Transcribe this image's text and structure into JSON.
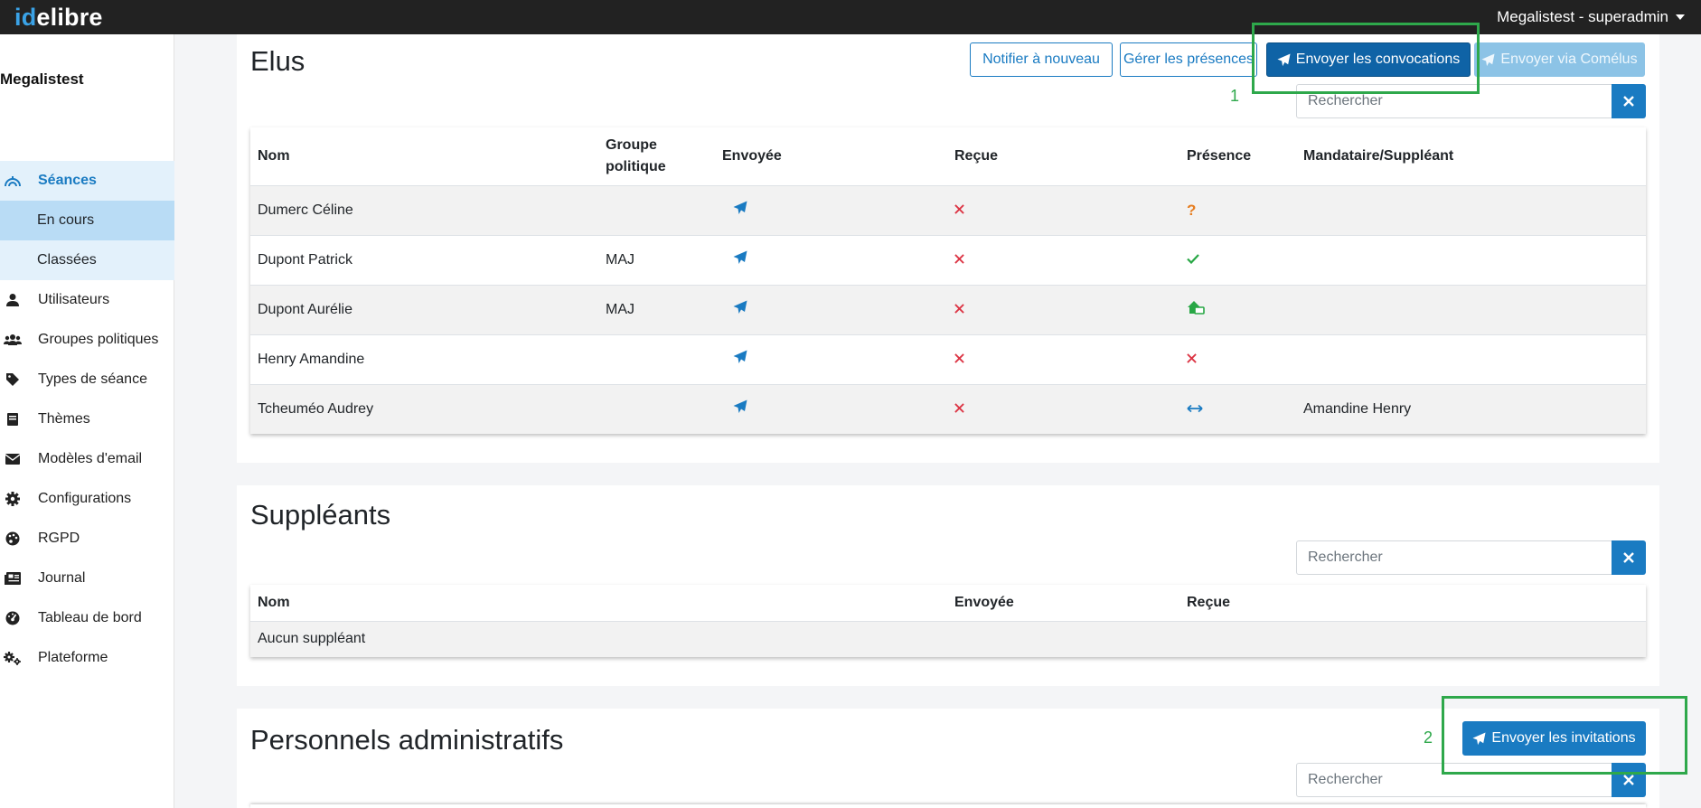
{
  "app": {
    "brand_part1": "id",
    "brand_part2": "elibre",
    "user": "Megalistest - superadmin"
  },
  "sidebar": {
    "title": "Megalistest",
    "items": [
      {
        "label": "Séances",
        "icon": "podium-icon"
      },
      {
        "label": "Utilisateurs",
        "icon": "user-icon"
      },
      {
        "label": "Groupes politiques",
        "icon": "users-icon"
      },
      {
        "label": "Types de séance",
        "icon": "tag-icon"
      },
      {
        "label": "Thèmes",
        "icon": "book-icon"
      },
      {
        "label": "Modèles d'email",
        "icon": "envelope-icon"
      },
      {
        "label": "Configurations",
        "icon": "gear-icon"
      },
      {
        "label": "RGPD",
        "icon": "palette-icon"
      },
      {
        "label": "Journal",
        "icon": "newspaper-icon"
      },
      {
        "label": "Tableau de bord",
        "icon": "dashboard-icon"
      },
      {
        "label": "Plateforme",
        "icon": "gears-icon"
      }
    ],
    "sub_items": [
      "En cours",
      "Classées"
    ]
  },
  "elus": {
    "title": "Elus",
    "buttons": {
      "notify": "Notifier à nouveau",
      "presences": "Gérer les présences",
      "send": "Envoyer les convocations",
      "comelus": "Envoyer via Comélus"
    },
    "search_placeholder": "Rechercher",
    "columns": [
      "Nom",
      "Groupe politique",
      "Envoyée",
      "Reçue",
      "Présence",
      "Mandataire/Suppléant"
    ],
    "rows": [
      {
        "nom": "Dumerc Céline",
        "groupe": "",
        "envoyee": "sent-icon",
        "recue": "cross-icon",
        "presence": "question-icon",
        "presence_color": "#e67e22",
        "mandataire": ""
      },
      {
        "nom": "Dupont Patrick",
        "groupe": "MAJ",
        "envoyee": "sent-icon",
        "recue": "cross-icon",
        "presence": "check-icon",
        "presence_color": "#28a745",
        "mandataire": ""
      },
      {
        "nom": "Dupont Aurélie",
        "groupe": "MAJ",
        "envoyee": "sent-icon",
        "recue": "cross-icon",
        "presence": "remote-icon",
        "presence_color": "#28a745",
        "mandataire": ""
      },
      {
        "nom": "Henry Amandine",
        "groupe": "",
        "envoyee": "sent-icon",
        "recue": "cross-icon",
        "presence": "cross-icon",
        "presence_color": "#dc3545",
        "mandataire": ""
      },
      {
        "nom": "Tcheuméo Audrey",
        "groupe": "",
        "envoyee": "sent-icon",
        "recue": "cross-icon",
        "presence": "arrows-icon",
        "presence_color": "#1a7bc2",
        "mandataire": "Amandine Henry"
      }
    ]
  },
  "suppleants": {
    "title": "Suppléants",
    "search_placeholder": "Rechercher",
    "columns": [
      "Nom",
      "Envoyée",
      "Reçue"
    ],
    "empty": "Aucun suppléant"
  },
  "personnels": {
    "title": "Personnels administratifs",
    "button": "Envoyer les invitations",
    "search_placeholder": "Rechercher"
  },
  "annotations": [
    "1",
    "2"
  ],
  "colors": {
    "primary": "#1a7bc2",
    "annotation": "#2ea84b",
    "danger": "#dc3545"
  }
}
